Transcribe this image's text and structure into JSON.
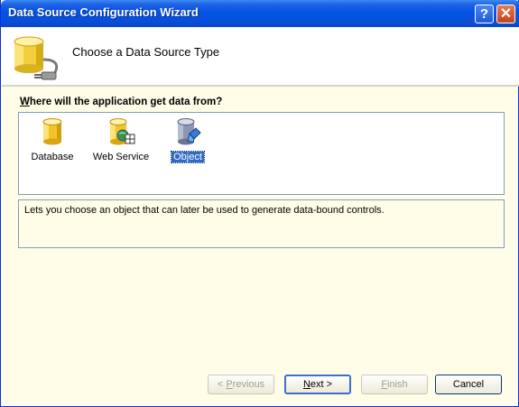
{
  "window": {
    "title": "Data Source Configuration Wizard"
  },
  "titlebar_buttons": {
    "help": "?",
    "close": "✕"
  },
  "header": {
    "title": "Choose a Data Source Type"
  },
  "question": {
    "accesskey": "W",
    "rest": "here will the application get data from?"
  },
  "data_sources": [
    {
      "label": "Database",
      "icon": "database-icon",
      "selected": false
    },
    {
      "label": "Web Service",
      "icon": "web-service-icon",
      "selected": false
    },
    {
      "label": "Object",
      "icon": "object-icon",
      "selected": true
    }
  ],
  "description": "Lets you choose an object that can later be used to generate data-bound controls.",
  "buttons": {
    "previous": {
      "prefix": "< ",
      "accesskey": "P",
      "rest": "revious",
      "enabled": false
    },
    "next": {
      "accesskey": "N",
      "rest": "ext >",
      "enabled": true
    },
    "finish": {
      "accesskey": "F",
      "rest": "inish",
      "enabled": false
    },
    "cancel": {
      "label": "Cancel",
      "enabled": true
    }
  },
  "colors": {
    "titlebar": "#0a4fd8",
    "body_background": "#fffde7",
    "selection": "#316ac5"
  }
}
